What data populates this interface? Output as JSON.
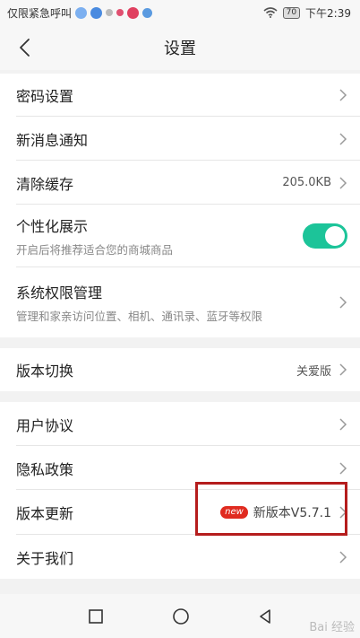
{
  "status_bar": {
    "carrier_text": "仅限紧急呼叫",
    "battery": "70",
    "time": "下午2:39"
  },
  "header": {
    "title": "设置"
  },
  "rows": {
    "password": {
      "label": "密码设置"
    },
    "notifications": {
      "label": "新消息通知"
    },
    "cache": {
      "label": "清除缓存",
      "value": "205.0KB"
    },
    "personalized": {
      "label": "个性化展示",
      "sub": "开启后将推荐适合您的商城商品",
      "enabled": true
    },
    "permissions": {
      "label": "系统权限管理",
      "sub": "管理和家亲访问位置、相机、通讯录、蓝牙等权限"
    },
    "version_switch": {
      "label": "版本切换",
      "value": "关爱版"
    },
    "user_agreement": {
      "label": "用户协议"
    },
    "privacy": {
      "label": "隐私政策"
    },
    "update": {
      "label": "版本更新",
      "badge": "new",
      "value": "新版本V5.7.1"
    },
    "about": {
      "label": "关于我们"
    }
  },
  "colors": {
    "toggle_on": "#1cc499",
    "badge": "#e02b20",
    "highlight": "#b51d1d"
  },
  "icons": [
    "back-arrow-icon",
    "chevron-right-icon",
    "square-icon",
    "circle-icon",
    "triangle-back-icon",
    "wifi-icon",
    "battery-icon"
  ],
  "watermark": "Bai 经验"
}
